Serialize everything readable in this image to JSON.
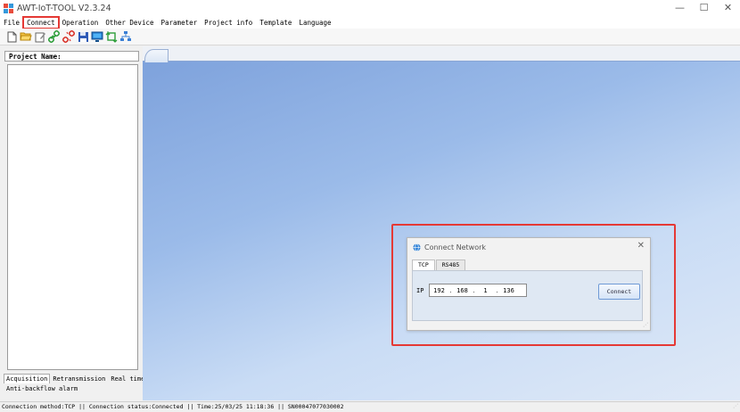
{
  "window": {
    "title": "AWT-IoT-TOOL V2.3.24",
    "controls": {
      "minimize": "—",
      "maximize": "☐",
      "close": "✕"
    }
  },
  "menu": {
    "items": [
      "File",
      "Connect",
      "Operation",
      "Other Device",
      "Parameter",
      "Project info",
      "Template",
      "Language"
    ],
    "active": "Connect"
  },
  "toolbar": {
    "icons": [
      "new-file-icon",
      "open-folder-icon",
      "edit-icon",
      "link-icon",
      "unlink-icon",
      "save-icon",
      "monitor-icon",
      "transfer-icon",
      "network-icon"
    ]
  },
  "left_panel": {
    "project_label": "Project Name:",
    "tabs_row1": [
      "Acquisition",
      "Retransmission",
      "Real time"
    ],
    "tabs_row2": [
      "Anti-backflow alarm"
    ],
    "selected_tab": "Acquisition"
  },
  "dialog": {
    "title": "Connect Network",
    "close": "✕",
    "tabs": [
      "TCP",
      "RS485"
    ],
    "selected_tab": "TCP",
    "ip_label": "IP",
    "ip_octets": [
      "192",
      "168",
      "1",
      "136"
    ],
    "ip_separator": ".",
    "connect_button": "Connect"
  },
  "status_bar": {
    "text": "Connection method:TCP || Connection status:Connected || Time:25/03/25 11:18:36 || SN00047077030002"
  },
  "colors": {
    "highlight": "#e53935",
    "workspace_top": "#7ea2dc",
    "workspace_bottom": "#dfe9f7"
  }
}
